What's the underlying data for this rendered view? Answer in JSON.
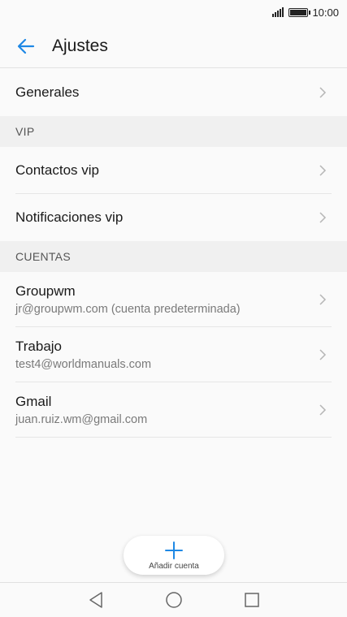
{
  "status_bar": {
    "time": "10:00"
  },
  "header": {
    "title": "Ajustes"
  },
  "general": {
    "label": "Generales"
  },
  "vip": {
    "section_title": "VIP",
    "items": [
      {
        "label": "Contactos vip"
      },
      {
        "label": "Notificaciones vip"
      }
    ]
  },
  "accounts": {
    "section_title": "CUENTAS",
    "items": [
      {
        "name": "Groupwm",
        "email": "jr@groupwm.com (cuenta predeterminada)"
      },
      {
        "name": "Trabajo",
        "email": "test4@worldmanuals.com"
      },
      {
        "name": "Gmail",
        "email": "juan.ruiz.wm@gmail.com"
      }
    ]
  },
  "fab": {
    "label": "Añadir cuenta",
    "icon": "plus-icon"
  },
  "colors": {
    "accent": "#1e88e5",
    "section_bg": "#f0f0f0",
    "background": "#fafafa"
  }
}
